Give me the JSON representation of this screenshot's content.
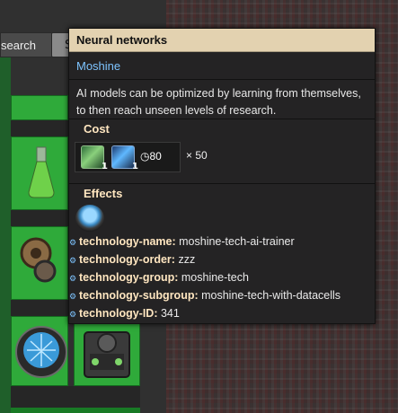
{
  "search": {
    "label": "search",
    "button_label": "S"
  },
  "tooltip": {
    "title": "Neural networks",
    "mod": "Moshine",
    "description_line1": "AI models can be optimized by learning from themselves,",
    "description_line2": "to then reach unseen levels of research.",
    "cost": {
      "label": "Cost",
      "pack1_count": "1",
      "pack2_count": "1",
      "time": "80",
      "multiplier": "× 50"
    },
    "effects": {
      "label": "Effects",
      "rows": [
        {
          "key": "technology-name:",
          "value": "moshine-tech-ai-trainer"
        },
        {
          "key": "technology-order:",
          "value": "zzz"
        },
        {
          "key": "technology-group:",
          "value": "moshine-tech"
        },
        {
          "key": "technology-subgroup:",
          "value": "moshine-tech-with-datacells"
        },
        {
          "key": "technology-ID:",
          "value": "341"
        }
      ]
    }
  },
  "colors": {
    "tile_green": "#2faa3a",
    "title_bar": "#e3d2b0",
    "mod_blue": "#7ec4ff",
    "label_cream": "#ffe6c0"
  },
  "icons": [
    "flask-icon",
    "science-pack-icon",
    "gear-icon",
    "ai-trainer-icon",
    "clock-icon"
  ]
}
